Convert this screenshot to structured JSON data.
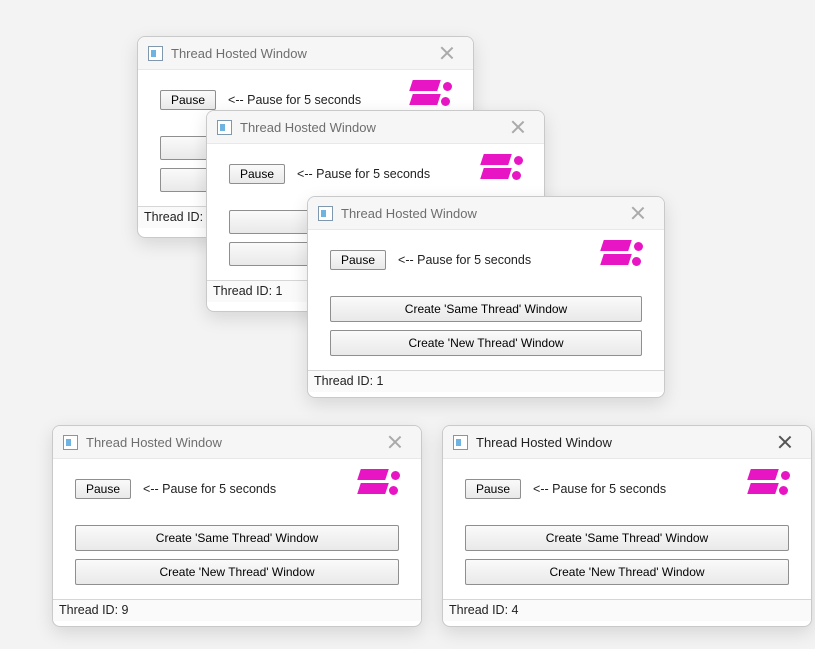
{
  "common": {
    "title": "Thread Hosted Window",
    "pause_label": "Pause",
    "pause_hint": "<-- Pause for 5 seconds",
    "same_thread_label": "Create 'Same Thread' Window",
    "new_thread_label": "Create 'New Thread' Window"
  },
  "windows": [
    {
      "id": "w1",
      "active": false,
      "thread_status": "Thread ID: 1"
    },
    {
      "id": "w2",
      "active": false,
      "thread_status": "Thread ID: 1"
    },
    {
      "id": "w3",
      "active": false,
      "thread_status": "Thread ID: 1"
    },
    {
      "id": "w4",
      "active": false,
      "thread_status": "Thread ID: 9"
    },
    {
      "id": "w5",
      "active": true,
      "thread_status": "Thread ID: 4"
    }
  ]
}
